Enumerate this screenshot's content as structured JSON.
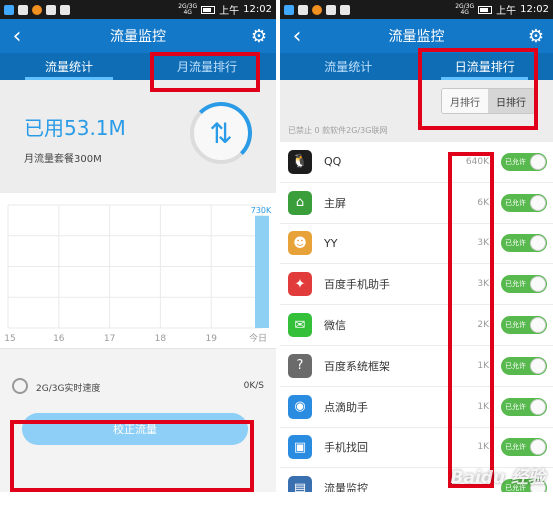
{
  "status_bar": {
    "net_top": "2G/3G",
    "net_bottom": "4G",
    "meridiem": "上午",
    "time": "12:02"
  },
  "title_bar": {
    "title": "流量监控"
  },
  "tabs": [
    {
      "label": "流量统计"
    },
    {
      "label": "月流量排行"
    },
    {
      "label": "日流量排行"
    }
  ],
  "summary": {
    "used": "已用53.1M",
    "plan": "月流量套餐300M"
  },
  "chart_data": {
    "type": "bar",
    "categories": [
      "15",
      "16",
      "17",
      "18",
      "19",
      "今日"
    ],
    "values": [
      0,
      0,
      0,
      0,
      0,
      730
    ],
    "data_labels": [
      "730K"
    ],
    "unit": "K",
    "ylim": [
      0,
      800
    ],
    "grid": true
  },
  "speed": {
    "label": "2G/3G实时速度",
    "value": "0K/S"
  },
  "calibrate": {
    "label": "校正流量"
  },
  "rank": {
    "segment": [
      {
        "label": "月排行"
      },
      {
        "label": "日排行"
      }
    ],
    "disabled_note": "已禁止 0 款软件2G/3G联网",
    "apps": [
      {
        "name": "QQ",
        "usage": "640K",
        "icon": "penguin-icon",
        "color": "#1d1d1d",
        "glyph": "🐧",
        "toggle": "已允许"
      },
      {
        "name": "主屏",
        "usage": "6K",
        "icon": "home-icon",
        "color": "#3a9e3a",
        "glyph": "⌂",
        "toggle": "已允许"
      },
      {
        "name": "YY",
        "usage": "3K",
        "icon": "yy-mascot-icon",
        "color": "#e8a23a",
        "glyph": "☻",
        "toggle": "已允许"
      },
      {
        "name": "百度手机助手",
        "usage": "3K",
        "icon": "baidu-assistant-icon",
        "color": "#e23b3b",
        "glyph": "✦",
        "toggle": "已允许"
      },
      {
        "name": "微信",
        "usage": "2K",
        "icon": "wechat-icon",
        "color": "#35c03a",
        "glyph": "✉",
        "toggle": "已允许"
      },
      {
        "name": "百度系统框架",
        "usage": "1K",
        "icon": "baidu-framework-icon",
        "color": "#6b6b6b",
        "glyph": "?",
        "toggle": "已允许"
      },
      {
        "name": "点滴助手",
        "usage": "1K",
        "icon": "water-drop-icon",
        "color": "#2a8ce0",
        "glyph": "◉",
        "toggle": "已允许"
      },
      {
        "name": "手机找回",
        "usage": "1K",
        "icon": "phone-finder-icon",
        "color": "#2a8ce0",
        "glyph": "▣",
        "toggle": "已允许"
      },
      {
        "name": "流量监控",
        "usage": "",
        "icon": "traffic-monitor-icon",
        "color": "#3a6fb0",
        "glyph": "▤",
        "toggle": "已允许"
      }
    ]
  },
  "watermark": "Baidu 经验",
  "colors": {
    "titlebar": "#1478c8",
    "tabbar": "#0f6db6",
    "accent": "#2a9be6",
    "highlight": "#e0001a",
    "toggle_on": "#58b94e"
  }
}
